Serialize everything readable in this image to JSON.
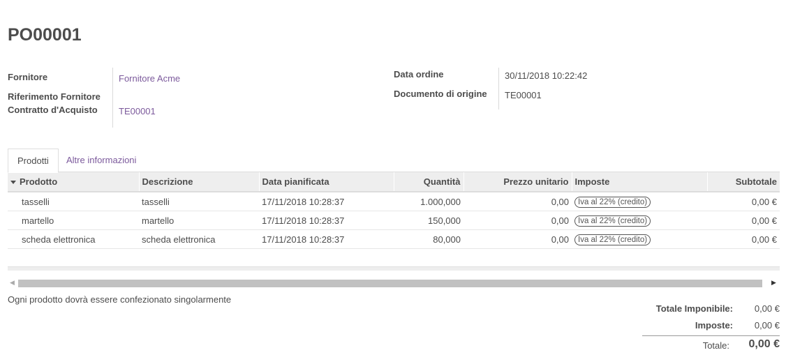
{
  "order": {
    "title": "PO00001"
  },
  "fields": {
    "vendor_label": "Fornitore",
    "vendor_value": "Fornitore Acme",
    "vendor_ref_label": "Riferimento Fornitore",
    "contract_label": "Contratto d'Acquisto",
    "contract_value": "TE00001",
    "order_date_label": "Data ordine",
    "order_date_value": "30/11/2018 10:22:42",
    "origin_label": "Documento di origine",
    "origin_value": "TE00001"
  },
  "tabs": [
    {
      "label": "Prodotti"
    },
    {
      "label": "Altre informazioni"
    }
  ],
  "lines": {
    "headers": [
      "Prodotto",
      "Descrizione",
      "Data pianificata",
      "Quantità",
      "Prezzo unitario",
      "Imposte",
      "Subtotale"
    ],
    "rows": [
      {
        "product": "tasselli",
        "description": "tasselli",
        "date": "17/11/2018 10:28:37",
        "qty": "1.000,000",
        "price": "0,00",
        "tax": "Iva al 22% (credito)",
        "subtotal": "0,00 €"
      },
      {
        "product": "martello",
        "description": "martello",
        "date": "17/11/2018 10:28:37",
        "qty": "150,000",
        "price": "0,00",
        "tax": "Iva al 22% (credito)",
        "subtotal": "0,00 €"
      },
      {
        "product": "scheda elettronica",
        "description": "scheda elettronica",
        "date": "17/11/2018 10:28:37",
        "qty": "80,000",
        "price": "0,00",
        "tax": "Iva al 22% (credito)",
        "subtotal": "0,00 €"
      }
    ]
  },
  "notes": "Ogni prodotto dovrà essere confezionato singolarmente",
  "totals": {
    "untaxed_label": "Totale Imponibile:",
    "untaxed_value": "0,00 €",
    "taxes_label": "Imposte:",
    "taxes_value": "0,00 €",
    "total_label": "Totale:",
    "total_value": "0,00 €"
  }
}
